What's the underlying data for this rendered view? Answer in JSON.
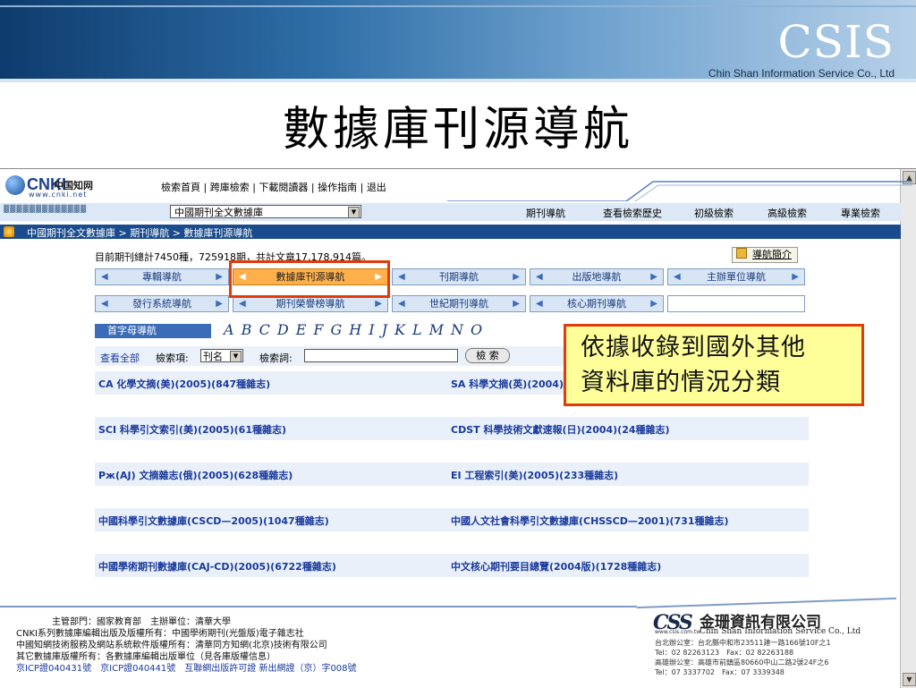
{
  "slide": {
    "logo": "CSIS",
    "company": "Chin Shan Information Service Co., Ltd",
    "title": "數據庫刊源導航"
  },
  "browser": {
    "cnki_logo": {
      "brand": "CNKI",
      "chinese": "中国知网",
      "url": "www.cnki.net"
    },
    "top_links": [
      "檢索首頁",
      "跨庫檢索",
      "下載閱讀器",
      "操作指南",
      "退出"
    ],
    "db_select": "中國期刊全文數據庫",
    "top_nav": [
      "期刊導航",
      "查看檢索歷史",
      "初級檢索",
      "高級檢索",
      "專業檢索"
    ],
    "breadcrumb": "中國期刊全文數據庫 > 期刊導航 > 數據庫刊源導航",
    "stats": "目前期刊總計7450種，725918期，共計文章17,178,914篇。",
    "guide_link": "導航簡介",
    "nav_row1": [
      "專輯導航",
      "數據庫刊源導航",
      "刊期導航",
      "出版地導航",
      "主辦單位導航"
    ],
    "nav_row2": [
      "發行系統導航",
      "期刊榮譽榜導航",
      "世紀期刊導航",
      "核心期刊導航"
    ],
    "alpha_tab": "首字母導航",
    "letters": [
      "A",
      "B",
      "C",
      "D",
      "E",
      "F",
      "G",
      "H",
      "I",
      "J",
      "K",
      "L",
      "M",
      "N",
      "O"
    ],
    "search": {
      "view_all": "查看全部",
      "field_label": "檢索項:",
      "field_value": "刊名",
      "keyword_label": "檢索詞:",
      "keyword_value": "",
      "button": "檢 索"
    },
    "results": [
      [
        "CA 化學文摘(美)(2005)(847種雜志)",
        "SA 科學文摘(英)(2004)"
      ],
      [
        "SCI 科學引文索引(美)(2005)(61種雜志)",
        "CDST 科學技術文獻速報(日)(2004)(24種雜志)"
      ],
      [
        "Рж(AJ) 文摘雜志(俄)(2005)(628種雜志)",
        "EI 工程索引(美)(2005)(233種雜志)"
      ],
      [
        "中國科學引文數據庫(CSCD—2005)(1047種雜志)",
        "中國人文社會科學引文數據庫(CHSSCD—2001)(731種雜志)"
      ],
      [
        "中國學術期刊數據庫(CAJ-CD)(2005)(6722種雜志)",
        "中文核心期刊要目總覽(2004版)(1728種雜志)"
      ]
    ],
    "footer": [
      "主管部門：國家教育部　主辦單位：清華大學",
      "CNKI系列數據庫編輯出版及版權所有：中國學術期刊(光盤版)電子雜志社",
      "中國知網技術服務及網站系統軟件版權所有：清華同方知網(北京)技術有限公司",
      "其它數據庫版權所有：各數據庫編輯出版單位（見各庫版權信息）",
      "京ICP證040431號　京ICP證040441號　互聯網出版許可證 新出網證（京）字008號"
    ]
  },
  "callout": [
    "依據收錄到國外其他",
    "資料庫的情況分類"
  ],
  "cs_logo": {
    "mark": "CSS",
    "chinese_name": "金珊資訊有限公司",
    "english_name": "Chin Shan Information Service Co., Ltd",
    "website": "www.csis.com.tw",
    "addresses": [
      "台北辦公室：台北縣中和市23511建一路166號10F之1",
      "Tel：02 82263123　Fax：02 82263188",
      "高雄辦公室：高雄市前鎮區80660中山二路2號24F之6",
      "Tel：07 3337702　Fax：07 3339348"
    ]
  },
  "colors": {
    "accent_red": "#e33a0c",
    "callout_bg": "#ffff99",
    "nav_active": "#ffb04a",
    "link_blue": "#1a3a9c"
  }
}
